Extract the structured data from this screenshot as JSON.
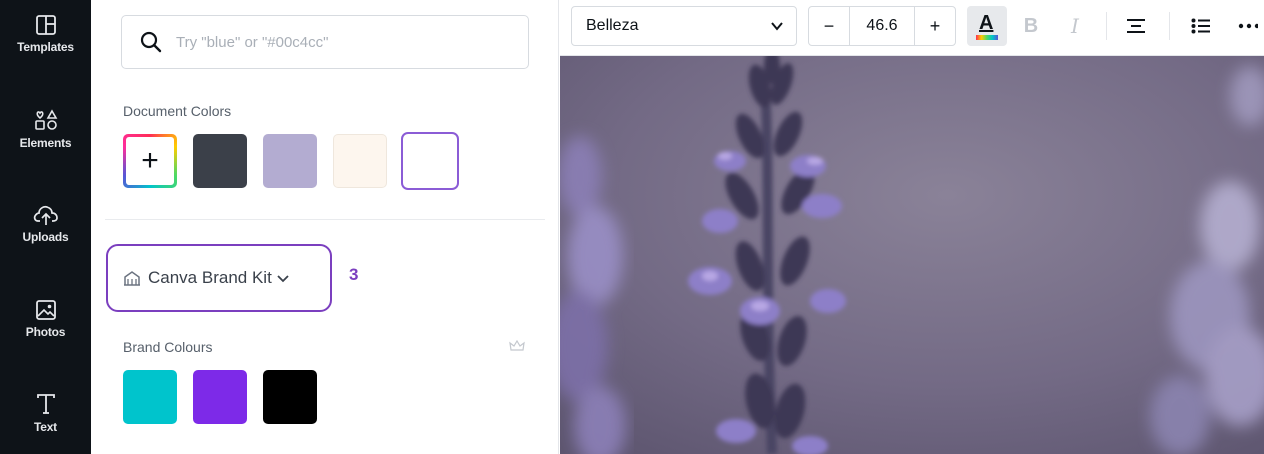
{
  "sidebar": {
    "items": [
      {
        "label": "Templates",
        "icon": "templates-icon"
      },
      {
        "label": "Elements",
        "icon": "elements-icon"
      },
      {
        "label": "Uploads",
        "icon": "uploads-icon"
      },
      {
        "label": "Photos",
        "icon": "photos-icon"
      },
      {
        "label": "Text",
        "icon": "text-icon"
      }
    ]
  },
  "panel": {
    "search": {
      "placeholder": "Try \"blue\" or \"#00c4cc\""
    },
    "document_colors": {
      "title": "Document Colors",
      "add_label": "+",
      "swatches": [
        "#3b4049",
        "#b3acd1",
        "#fdf6ee",
        "#ffffff"
      ],
      "selected_border": "#8b5cd6"
    },
    "brand_kit": {
      "label": "Canva Brand Kit",
      "step_number": "3",
      "highlight_color": "#7b3fbf"
    },
    "brand_colours": {
      "title": "Brand Colours",
      "swatches": [
        "#00c4cc",
        "#7d2ae8",
        "#000000"
      ]
    }
  },
  "toolbar": {
    "font_name": "Belleza",
    "font_size": "46.6",
    "decrease_label": "−",
    "increase_label": "+",
    "text_color_letter": "A",
    "bold_label": "B",
    "italic_label": "I"
  },
  "colors": {
    "sidebar_bg": "#0e1318",
    "accent_purple": "#7b3fbf",
    "canvas_bg": "#6f6880"
  }
}
